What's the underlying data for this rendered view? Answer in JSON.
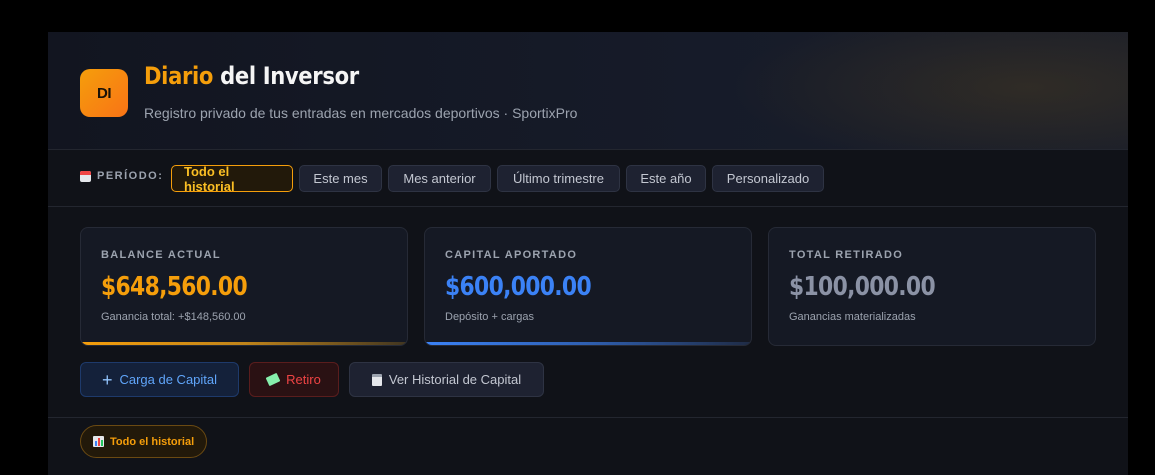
{
  "header": {
    "logo_text": "DI",
    "title_accent": "Diario",
    "title_rest": " del Inversor",
    "subtitle": "Registro privado de tus entradas en mercados deportivos · SportixPro"
  },
  "period": {
    "label": "PERÍODO:",
    "options": [
      "Todo el historial",
      "Este mes",
      "Mes anterior",
      "Último trimestre",
      "Este año",
      "Personalizado"
    ],
    "selected": "Todo el historial"
  },
  "cards": [
    {
      "label": "BALANCE ACTUAL",
      "value": "$648,560.00",
      "note": "Ganancia total: +$148,560.00",
      "color": "#f59e0b"
    },
    {
      "label": "CAPITAL APORTADO",
      "value": "$600,000.00",
      "note": "Depósito + cargas",
      "color": "#3b82f6"
    },
    {
      "label": "TOTAL RETIRADO",
      "value": "$100,000.00",
      "note": "Ganancias materializadas",
      "color": "#8b92a5"
    }
  ],
  "actions": {
    "carga": "Carga de Capital",
    "retiro": "Retiro",
    "historial": "Ver Historial de Capital"
  },
  "filter_chip": "Todo el historial",
  "icons": {
    "calendar": "calendar-icon",
    "plus": "plus-icon",
    "money": "money-wings-icon",
    "clipboard": "clipboard-icon",
    "bar_chart": "bar-chart-icon"
  }
}
